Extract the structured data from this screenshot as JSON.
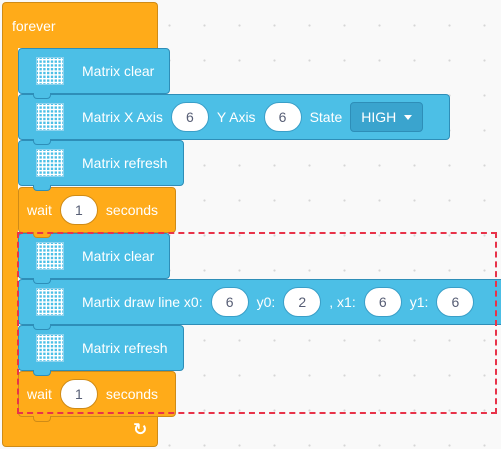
{
  "forever": {
    "label": "forever",
    "loop_icon": "loop-arrow-icon"
  },
  "blocks": [
    {
      "type": "matrix-clear",
      "label": "Matrix clear"
    },
    {
      "type": "matrix-set",
      "label_x": "Matrix X Axis",
      "x": "6",
      "label_y": "Y Axis",
      "y": "6",
      "label_state": "State",
      "state": "HIGH"
    },
    {
      "type": "matrix-refresh",
      "label": "Matrix refresh"
    },
    {
      "type": "wait",
      "label_wait": "wait",
      "value": "1",
      "label_unit": "seconds"
    },
    {
      "type": "matrix-clear",
      "label": "Matrix clear"
    },
    {
      "type": "matrix-line",
      "label": "Martix draw line x0:",
      "x0": "6",
      "label_y0": "y0:",
      "y0": "2",
      "label_x1": ", x1:",
      "x1": "6",
      "label_y1": "y1:",
      "y1": "6"
    },
    {
      "type": "matrix-refresh",
      "label": "Matrix refresh"
    },
    {
      "type": "wait",
      "label_wait": "wait",
      "value": "1",
      "label_unit": "seconds"
    }
  ],
  "colors": {
    "control": "#FFAB19",
    "matrix": "#4CBFE6",
    "highlight": "#E8334A"
  }
}
